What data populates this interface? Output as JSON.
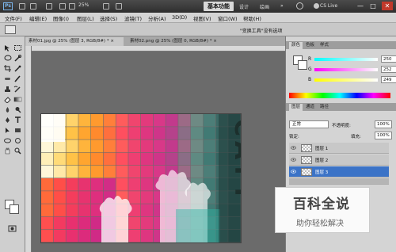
{
  "appbar": {
    "logo": "Ps",
    "zoom": "25%",
    "workspace": "基本功能",
    "workspace_links": [
      "设计",
      "绘画"
    ],
    "more": "»",
    "cslive": "CS Live",
    "window_buttons": [
      "—",
      "□",
      "✕"
    ]
  },
  "menu": [
    "文件(F)",
    "编辑(E)",
    "图像(I)",
    "图层(L)",
    "选择(S)",
    "滤镜(T)",
    "分析(A)",
    "3D(D)",
    "视图(V)",
    "窗口(W)",
    "帮助(H)"
  ],
  "options_bar": {
    "text": "\"变换工具\"没有选项"
  },
  "document_tabs": [
    {
      "label": "素材01.jpg @ 25% (图层 3, RGB/8#) *",
      "close": "×",
      "active": true
    },
    {
      "label": "素材02.png @ 25% (图层 0, RGB/8#) *",
      "close": "×",
      "active": false
    }
  ],
  "canvas": {
    "text": "CATT"
  },
  "color_panel": {
    "tabs": [
      "颜色",
      "色板",
      "样式"
    ],
    "channels": [
      {
        "name": "R",
        "value": "250"
      },
      {
        "name": "G",
        "value": "252"
      },
      {
        "name": "B",
        "value": "249"
      }
    ]
  },
  "layers_panel": {
    "tabs": [
      "图层",
      "通道",
      "路径"
    ],
    "blend_mode": "正常",
    "opacity_label": "不透明度:",
    "opacity_value": "100%",
    "lock_label": "锁定:",
    "fill_label": "填充:",
    "fill_value": "100%",
    "layers": [
      {
        "name": "图层 1",
        "selected": false
      },
      {
        "name": "图层 2",
        "selected": false
      },
      {
        "name": "图层 3",
        "selected": true
      }
    ]
  },
  "watermark": {
    "title": "百科全说",
    "subtitle": "助你轻松解决"
  }
}
